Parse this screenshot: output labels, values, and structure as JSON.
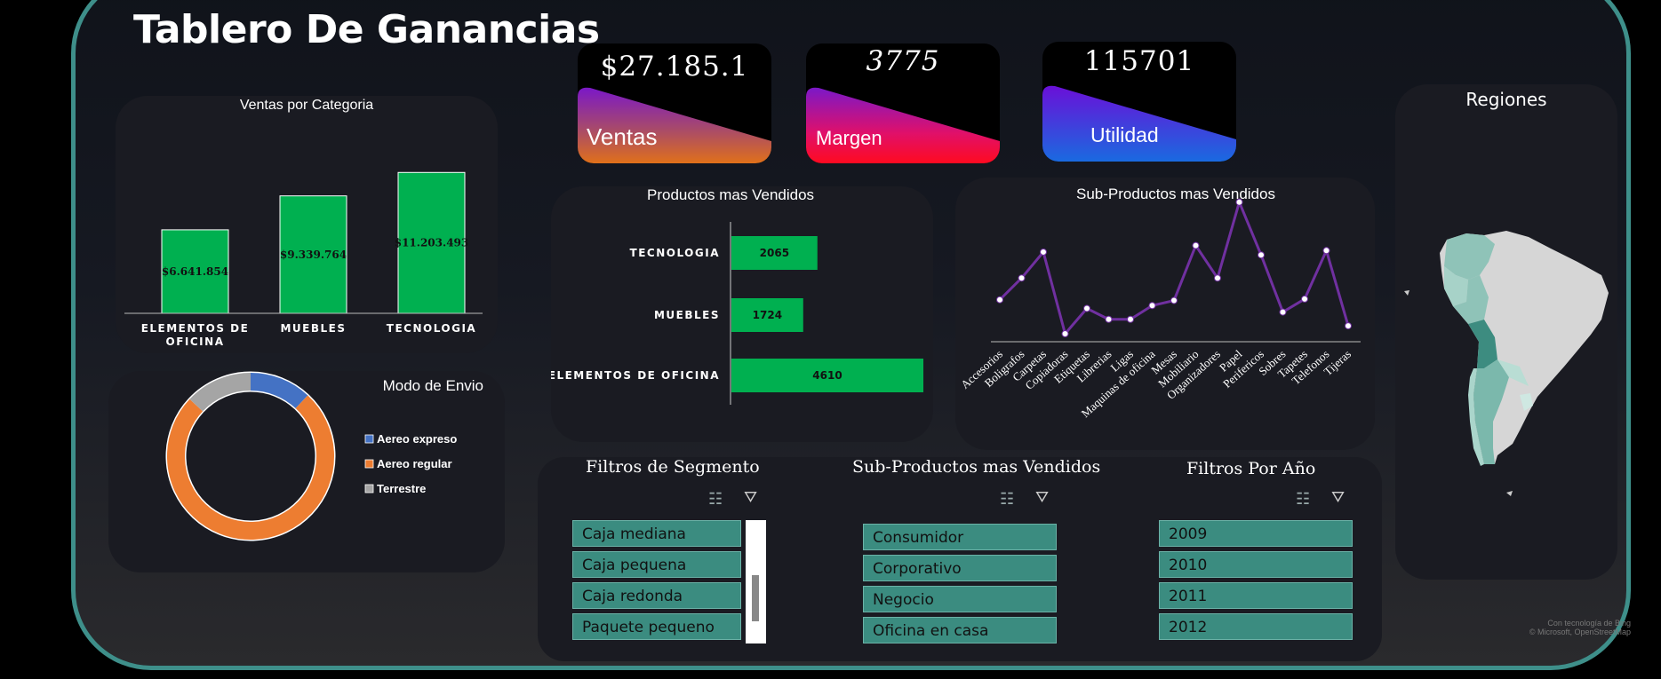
{
  "header": {
    "title": "Tablero De Ganancias"
  },
  "kpis": {
    "ventas": {
      "value": "$27.185.1",
      "label": "Ventas"
    },
    "margen": {
      "value": "3775",
      "label": "Margen"
    },
    "utilidad": {
      "value": "115701",
      "label": "Utilidad"
    }
  },
  "charts": {
    "categoria": {
      "title": "Ventas por Categoria",
      "chart_data": {
        "type": "bar",
        "categories": [
          "ELEMENTOS DE OFICINA",
          "MUEBLES",
          "TECNOLOGIA"
        ],
        "category_lines": [
          [
            "ELEMENTOS DE",
            "OFICINA"
          ],
          [
            "MUEBLES"
          ],
          [
            "TECNOLOGIA"
          ]
        ],
        "values": [
          6641854,
          9339764,
          11203493
        ],
        "data_labels": [
          "$6.641.854",
          "$9.339.764",
          "$11.203.493"
        ],
        "ylim": [
          0,
          12000000
        ],
        "color": "#00b050"
      }
    },
    "envio": {
      "title": "Modo de Envio",
      "chart_data": {
        "type": "pie",
        "labels": [
          "Aereo expreso",
          "Aereo regular",
          "Terrestre"
        ],
        "values": [
          12,
          75,
          13
        ],
        "colors": [
          "#4472c4",
          "#ed7d31",
          "#a5a5a5"
        ],
        "donut": true
      }
    },
    "productos": {
      "title": "Productos mas Vendidos",
      "chart_data": {
        "type": "bar",
        "orientation": "horizontal",
        "categories": [
          "TECNOLOGIA",
          "MUEBLES",
          "ELEMENTOS DE OFICINA"
        ],
        "values": [
          2065,
          1724,
          4610
        ],
        "xlim": [
          0,
          4610
        ],
        "color": "#00b050"
      }
    },
    "subproductos": {
      "title": "Sub-Productos mas Vendidos",
      "chart_data": {
        "type": "line",
        "categories": [
          "Accesorios",
          "Boligrafos",
          "Carpetas",
          "Copiadoras",
          "Etiquetas",
          "Librerias",
          "Ligas",
          "Maquinas de oficina",
          "Mesas",
          "Mobiliario",
          "Organizadores",
          "Papel",
          "Perifericos",
          "Sobres",
          "Tapetes",
          "Telefonos",
          "Tijeras"
        ],
        "values": [
          290,
          440,
          620,
          55,
          230,
          155,
          155,
          250,
          285,
          665,
          440,
          965,
          600,
          205,
          295,
          630,
          110
        ],
        "ylim": [
          0,
          1000
        ],
        "color": "#7030a0"
      }
    }
  },
  "map": {
    "title": "Regiones",
    "credit_line1": "Con tecnología de Bing",
    "credit_line2": "© Microsoft, OpenStreetMap"
  },
  "slicers": {
    "segmento": {
      "title": "Filtros de Segmento",
      "items": [
        "Caja mediana",
        "Caja pequena",
        "Caja redonda",
        "Paquete pequeno"
      ]
    },
    "subproductos": {
      "title": "Sub-Productos mas Vendidos",
      "items": [
        "Consumidor",
        "Corporativo",
        "Negocio",
        "Oficina en casa"
      ]
    },
    "anio": {
      "title": "Filtros Por Año",
      "items": [
        "2009",
        "2010",
        "2011",
        "2012"
      ]
    }
  }
}
